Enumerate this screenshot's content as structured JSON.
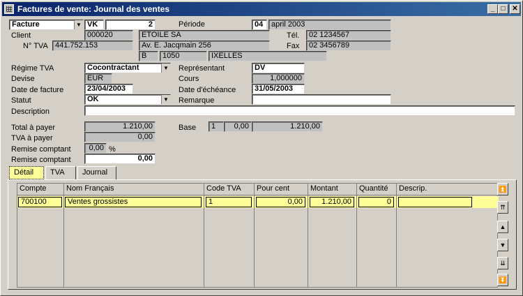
{
  "window": {
    "title": "Factures de vente: Journal des ventes"
  },
  "header": {
    "doc_type": "Facture",
    "journal": "VK",
    "number": "2",
    "periode_label": "Période",
    "periode_num": "04",
    "periode_name": "april 2003",
    "client_label": "Client",
    "client_code": "000020",
    "client_name": "ETOILE SA",
    "tel_label": "Tél.",
    "tel": "02 1234567",
    "tva_label": "N° TVA",
    "tva": "441.752.153",
    "address": "Av. E. Jacqmain 256",
    "fax_label": "Fax",
    "fax": "02 3456789",
    "country": "B",
    "zip": "1050",
    "city": "IXELLES"
  },
  "form": {
    "regime_label": "Régime TVA",
    "regime": "Cocontractant",
    "rep_label": "Représentant",
    "rep": "DV",
    "devise_label": "Devise",
    "devise": "EUR",
    "cours_label": "Cours",
    "cours": "1,000000",
    "date_label": "Date de facture",
    "date": "23/04/2003",
    "echeance_label": "Date d'échéance",
    "echeance": "31/05/2003",
    "statut_label": "Statut",
    "statut": "OK",
    "remarque_label": "Remarque",
    "remarque": "",
    "desc_label": "Description",
    "desc": ""
  },
  "totals": {
    "total_label": "Total à payer",
    "total": "1.210,00",
    "base_label": "Base",
    "base_code": "1",
    "base_a": "0,00",
    "base_b": "1.210,00",
    "tva_label": "TVA à payer",
    "tva": "0,00",
    "remise_label": "Remise comptant",
    "remise_pct": "0,00",
    "pct_sign": "%",
    "remise2_label": "Remise comptant",
    "remise2": "0,00"
  },
  "tabs": [
    {
      "label": "Détail"
    },
    {
      "label": "TVA"
    },
    {
      "label": "Journal"
    }
  ],
  "grid": {
    "columns": [
      "Compte",
      "Nom Français",
      "Code TVA",
      "Pour cent",
      "Montant",
      "Quantité",
      "Descrip."
    ],
    "rows": [
      {
        "compte": "700100",
        "nom": "Ventes grossistes",
        "code": "1",
        "pct": "0,00",
        "montant": "1.210,00",
        "qte": "0",
        "descr": ""
      }
    ]
  },
  "icons": {
    "minimize": "minimize-icon",
    "maximize": "maximize-icon",
    "close": "close-icon"
  }
}
